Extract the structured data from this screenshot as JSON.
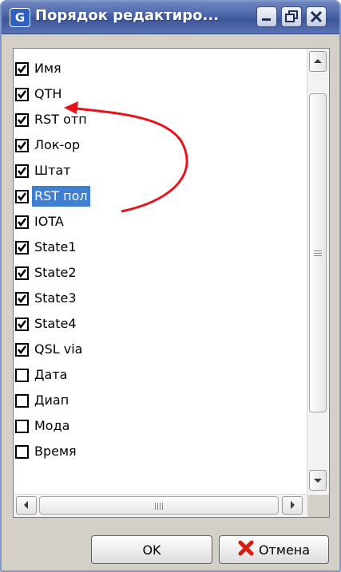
{
  "window": {
    "title": "Порядок редактиро...",
    "app_icon_letter": "G"
  },
  "titlebar_buttons": [
    "minimize-icon",
    "restore-icon",
    "close-icon"
  ],
  "list": {
    "items": [
      {
        "label": "Имя",
        "checked": true,
        "selected": false
      },
      {
        "label": "QTH",
        "checked": true,
        "selected": false
      },
      {
        "label": "RST отп",
        "checked": true,
        "selected": false
      },
      {
        "label": "Лок-ор",
        "checked": true,
        "selected": false
      },
      {
        "label": "Штат",
        "checked": true,
        "selected": false
      },
      {
        "label": "RST пол",
        "checked": true,
        "selected": true
      },
      {
        "label": "IOTA",
        "checked": true,
        "selected": false
      },
      {
        "label": "State1",
        "checked": true,
        "selected": false
      },
      {
        "label": "State2",
        "checked": true,
        "selected": false
      },
      {
        "label": "State3",
        "checked": true,
        "selected": false
      },
      {
        "label": "State4",
        "checked": true,
        "selected": false
      },
      {
        "label": "QSL via",
        "checked": true,
        "selected": false
      },
      {
        "label": "Дата",
        "checked": false,
        "selected": false
      },
      {
        "label": "Диап",
        "checked": false,
        "selected": false
      },
      {
        "label": "Мода",
        "checked": false,
        "selected": false
      },
      {
        "label": "Время",
        "checked": false,
        "selected": false
      }
    ]
  },
  "buttons": {
    "ok": "OK",
    "cancel": "Отмена"
  },
  "colors": {
    "selection": "#3e7fd1",
    "annotation_arrow": "#e8121a",
    "cancel_icon": "#d81c10"
  }
}
